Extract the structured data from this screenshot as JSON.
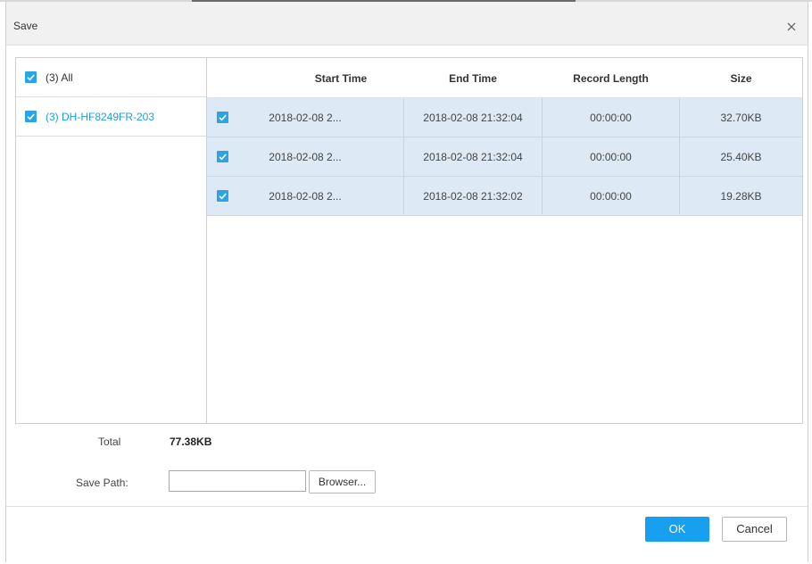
{
  "dialog": {
    "title": "Save",
    "close_icon": "close-icon"
  },
  "tree": {
    "all_label": "(3) All",
    "all_checked": true,
    "devices": [
      {
        "label": "(3) DH-HF8249FR-203",
        "checked": true
      }
    ]
  },
  "table": {
    "columns": [
      "Start Time",
      "End Time",
      "Record Length",
      "Size"
    ],
    "rows": [
      {
        "checked": true,
        "start": "2018-02-08 2...",
        "end": "2018-02-08 21:32:04",
        "length": "00:00:00",
        "size": "32.70KB"
      },
      {
        "checked": true,
        "start": "2018-02-08 2...",
        "end": "2018-02-08 21:32:04",
        "length": "00:00:00",
        "size": "25.40KB"
      },
      {
        "checked": true,
        "start": "2018-02-08 2...",
        "end": "2018-02-08 21:32:02",
        "length": "00:00:00",
        "size": "19.28KB"
      }
    ]
  },
  "footer": {
    "total_label": "Total",
    "total_value": "77.38KB",
    "save_path_label": "Save Path:",
    "save_path_value": "",
    "browse_label": "Browser...",
    "ok_label": "OK",
    "cancel_label": "Cancel"
  },
  "colors": {
    "accent": "#18a0f0",
    "checkbox": "#2aa4e6",
    "row_selected": "#ddeaf5",
    "link": "#1a9fe0"
  }
}
